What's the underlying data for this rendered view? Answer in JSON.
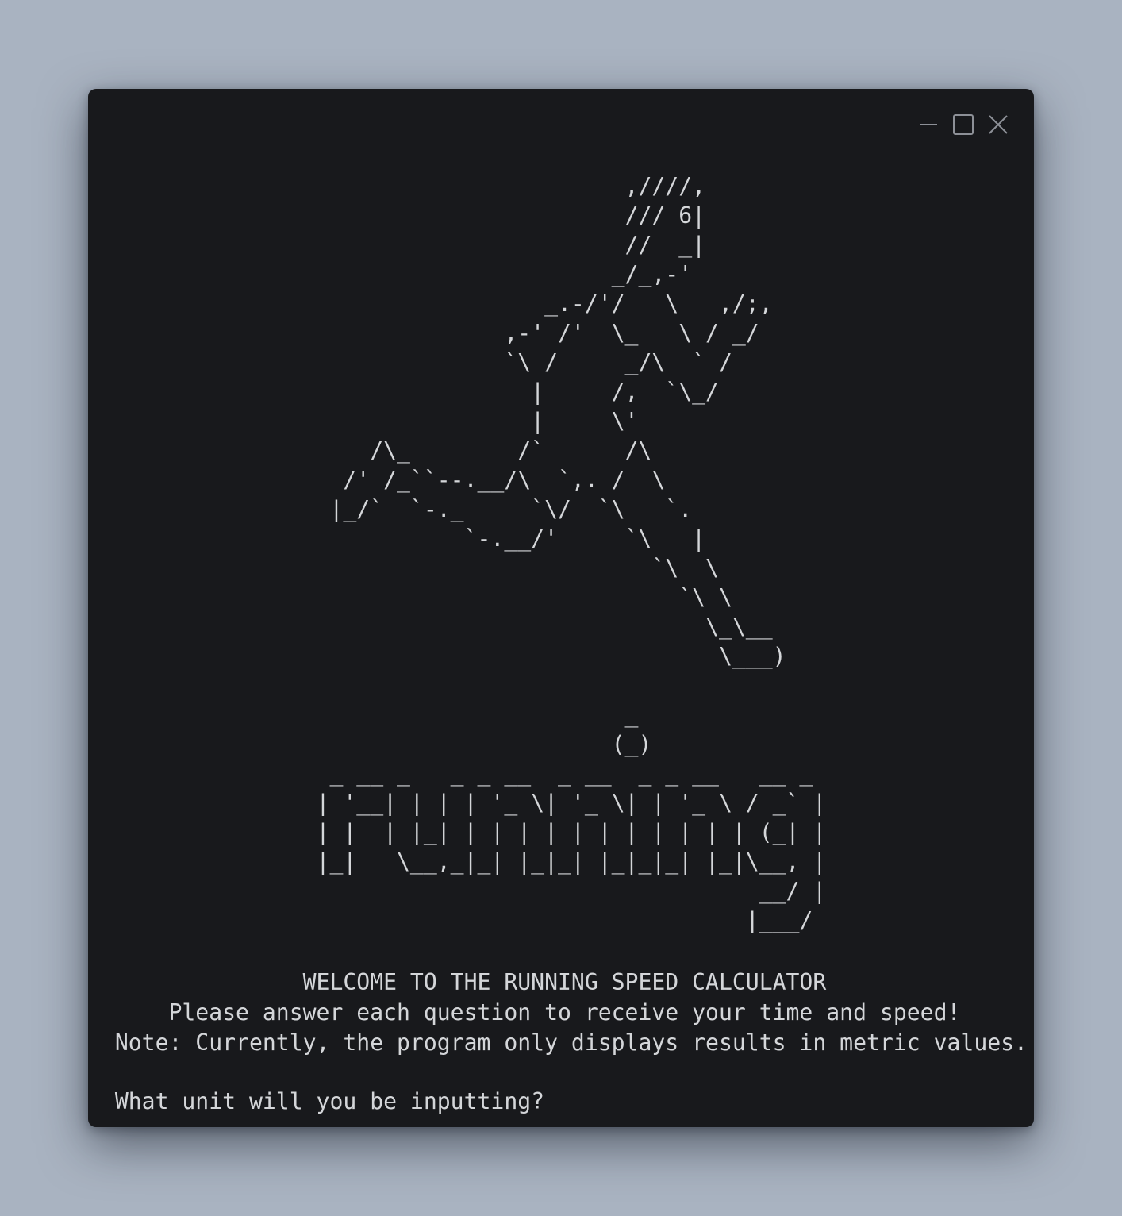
{
  "window": {
    "controls": {
      "minimize_icon": "minimize-icon",
      "maximize_icon": "maximize-icon",
      "close_icon": "close-icon"
    }
  },
  "terminal": {
    "lines": [
      "                                        ,////,",
      "                                        /// 6|",
      "                                        //  _|",
      "                                       _/_,-'",
      "                                  _.-/'/   \\   ,/;,",
      "                               ,-' /'  \\_   \\ / _/",
      "                               `\\ /     _/\\  ` /",
      "                                 |     /,  `\\_/",
      "                                 |     \\'",
      "                     /\\_        /`      /\\",
      "                   /' /_``--.__/\\  `,. /  \\",
      "                  |_/`  `-._     `\\/  `\\   `.",
      "                            `-.__/'     `\\   |",
      "                                          `\\  \\",
      "                                            `\\ \\",
      "                                              \\_\\__",
      "                                               \\___)",
      "",
      "                                        _",
      "                                       (_)",
      "                  _ __ _   _ _ __  _ __  _ _ __   __ _",
      "                 | '__| | | | '_ \\| '_ \\| | '_ \\ / _` |",
      "                 | |  | |_| | | | | | | | | | | | (_| |",
      "                 |_|   \\__,_|_| |_|_| |_|_|_| |_|\\__, |",
      "                                                  __/ |",
      "                                                 |___/",
      "",
      "                WELCOME TO THE RUNNING SPEED CALCULATOR",
      "      Please answer each question to receive your time and speed!",
      "  Note: Currently, the program only displays results in metric values.",
      "",
      "  What unit will you be inputting?"
    ]
  }
}
